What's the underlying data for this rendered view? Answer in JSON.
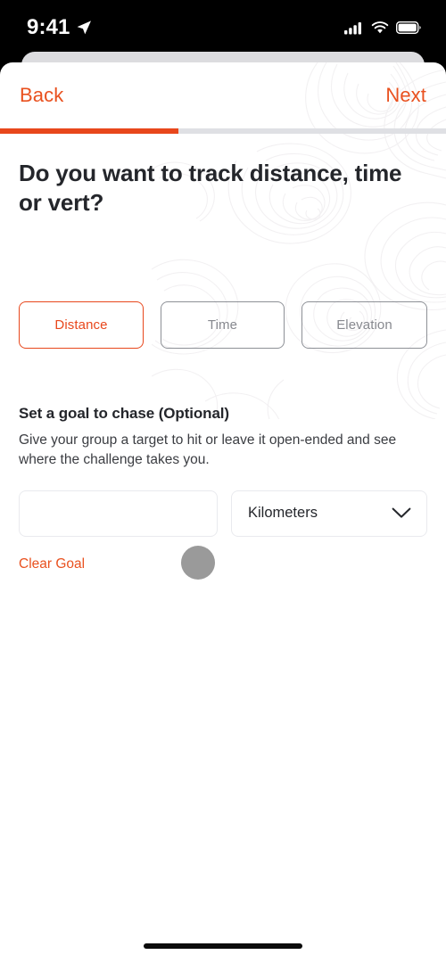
{
  "status_bar": {
    "time": "9:41",
    "location_icon": "location-arrow-icon",
    "cellular_icon": "cellular-signal-icon",
    "wifi_icon": "wifi-icon",
    "battery_icon": "battery-full-icon"
  },
  "nav": {
    "back_label": "Back",
    "next_label": "Next"
  },
  "progress": {
    "percent": 40,
    "fill_color": "#E8471C",
    "track_color": "#DFE0E4"
  },
  "page": {
    "title": "Do you want to track distance, time or vert?"
  },
  "tracking_options": [
    {
      "label": "Distance",
      "selected": true
    },
    {
      "label": "Time",
      "selected": false
    },
    {
      "label": "Elevation",
      "selected": false
    }
  ],
  "goal": {
    "title": "Set a goal to chase (Optional)",
    "description": "Give your group a target to hit or leave it open-ended and see where the challenge takes you.",
    "value": "",
    "placeholder": "",
    "unit_label": "Kilometers",
    "unit_chevron_icon": "chevron-down-icon",
    "clear_label": "Clear Goal"
  },
  "cursor": {
    "name": "tap-indicator",
    "color": "#9A9A9A"
  },
  "colors": {
    "accent": "#E8471C",
    "accent_text": "#E9511F",
    "text_primary": "#24262B",
    "text_muted": "#87898F"
  }
}
